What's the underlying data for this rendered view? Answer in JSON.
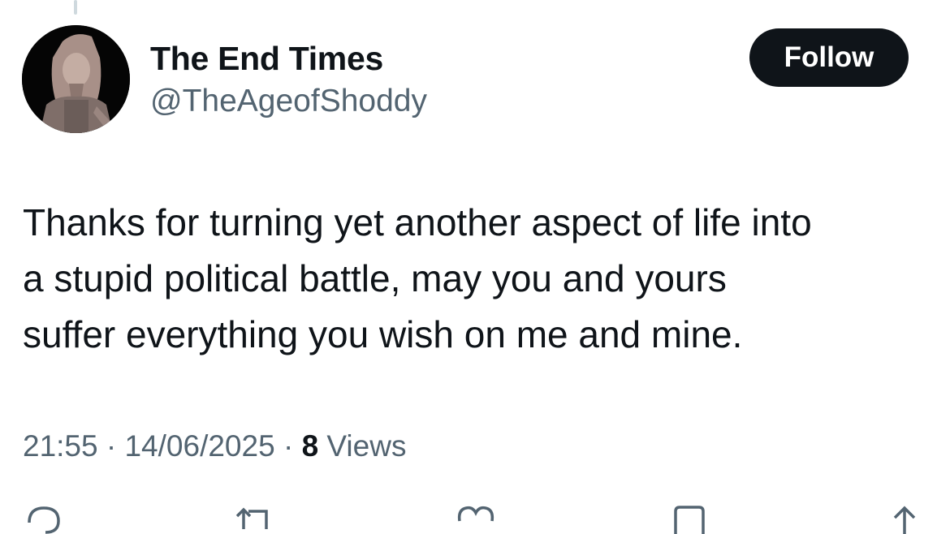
{
  "tweet": {
    "author": {
      "display_name": "The End Times",
      "handle": "@TheAgeofShoddy"
    },
    "follow_label": "Follow",
    "text_lines": [
      "Thanks for turning yet another aspect of life into",
      "a stupid political battle, may you and yours",
      "suffer everything you wish on me and mine."
    ],
    "meta": {
      "time": "21:55",
      "separator": "·",
      "date": "14/06/2025",
      "views_count": "8",
      "views_label": "Views"
    }
  },
  "actions": {
    "icons": [
      "reply-icon",
      "retweet-icon",
      "like-icon",
      "bookmark-icon",
      "share-icon"
    ]
  },
  "colors": {
    "text": "#0f1419",
    "secondary_text": "#536471",
    "button_bg": "#0f1419",
    "button_text": "#ffffff"
  }
}
